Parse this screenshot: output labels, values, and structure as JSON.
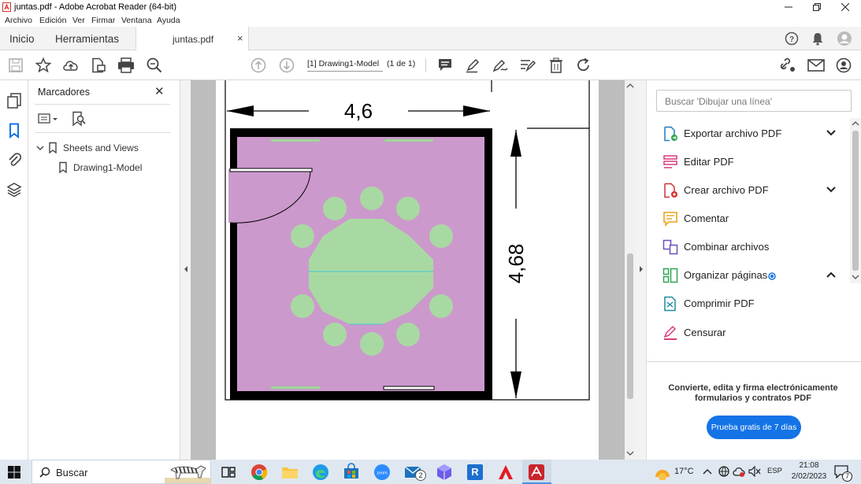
{
  "window": {
    "title": "juntas.pdf - Adobe Acrobat Reader (64-bit)",
    "minimize_icon": "minimize-icon",
    "maximize_icon": "restore-icon",
    "close_icon": "close-icon"
  },
  "menu": [
    "Archivo",
    "Edición",
    "Ver",
    "Firmar",
    "Ventana",
    "Ayuda"
  ],
  "tabs": {
    "home": "Inicio",
    "tools": "Herramientas",
    "document": "juntas.pdf",
    "close": "×"
  },
  "toolbar": {
    "page_label": "[1] Drawing1-Model",
    "page_count": "(1 de 1)"
  },
  "bookmarks": {
    "title": "Marcadores",
    "close": "✕",
    "root": "Sheets and Views",
    "child": "Drawing1-Model"
  },
  "drawing": {
    "width_dim": "4,6",
    "height_dim": "4,68",
    "colors": {
      "room": "#cc99cc",
      "furniture": "#a9d9a2",
      "wall": "#000000",
      "cyan": "#44c6d8"
    }
  },
  "tools_panel": {
    "search_placeholder": "Buscar 'Dibujar una línea'",
    "items": [
      {
        "label": "Exportar archivo PDF",
        "expanded": false
      },
      {
        "label": "Editar PDF"
      },
      {
        "label": "Crear archivo PDF",
        "expanded": false
      },
      {
        "label": "Comentar"
      },
      {
        "label": "Combinar archivos"
      },
      {
        "label": "Organizar páginas",
        "expanded": true
      },
      {
        "label": "Comprimir PDF"
      },
      {
        "label": "Censurar"
      }
    ],
    "promo": "Convierte, edita y firma electrónicamente formularios y contratos PDF",
    "trial_button": "Prueba gratis de 7 días"
  },
  "taskbar": {
    "search": "Buscar",
    "temperature": "17°C",
    "language": "ESP",
    "time": "21:08",
    "date": "2/02/2023",
    "notification_count": "7",
    "mail_badge": "2"
  }
}
